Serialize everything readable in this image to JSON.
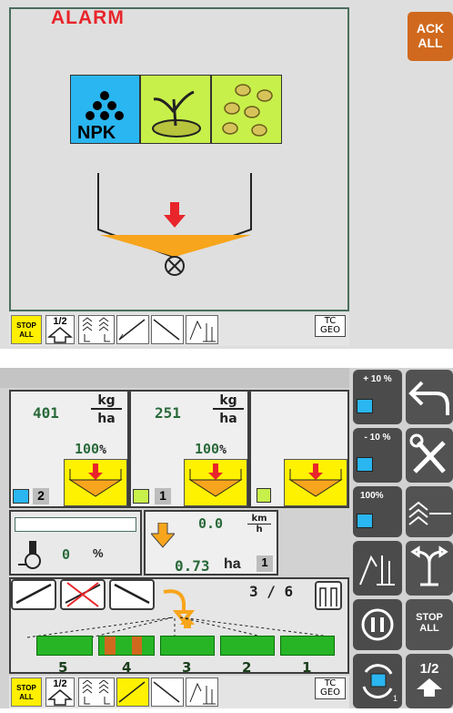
{
  "alarm": {
    "title": "ALARM",
    "products": [
      "npk",
      "seed",
      "granules"
    ],
    "npk_label": "NPK"
  },
  "ack_button": {
    "line1": "ACK",
    "line2": "ALL"
  },
  "bottom_bar_top": {
    "stop_line1": "STOP",
    "stop_line2": "ALL",
    "half": "1/2",
    "tc": "TC",
    "geo": "GEO"
  },
  "rates": [
    {
      "value": "401",
      "unit_top": "kg",
      "unit_bottom": "ha",
      "percent": "100",
      "product_num": "2"
    },
    {
      "value": "251",
      "unit_top": "kg",
      "unit_bottom": "ha",
      "percent": "100",
      "product_num": "1"
    },
    {
      "value": "",
      "unit_top": "",
      "unit_bottom": "",
      "percent": "",
      "product_num": ""
    }
  ],
  "speed": {
    "value": "0.0",
    "unit_top": "km",
    "unit_bottom": "h"
  },
  "pressure": {
    "value": "0",
    "unit": "%"
  },
  "area": {
    "value": "0.73",
    "unit": "ha",
    "index": "1"
  },
  "sections": {
    "counter": "3 / 6",
    "labels": [
      "5",
      "4",
      "3",
      "2",
      "1"
    ]
  },
  "side_buttons": {
    "plus": "+ 10 %",
    "minus": "- 10 %",
    "hundred": "100%",
    "stop_line1": "STOP",
    "stop_line2": "ALL",
    "half": "1/2",
    "circle_num": "1"
  },
  "bottom_bar": {
    "stop_line1": "STOP",
    "stop_line2": "ALL",
    "half": "1/2",
    "tc": "TC",
    "geo": "GEO"
  },
  "colors": {
    "alarm_red": "#e8252b",
    "ack_orange": "#d0691e",
    "npk_blue": "#2ab6f0",
    "seed_green": "#c8f04a",
    "hopper_orange": "#f7a51c",
    "active_yellow": "#fff200",
    "section_green": "#27b526"
  }
}
